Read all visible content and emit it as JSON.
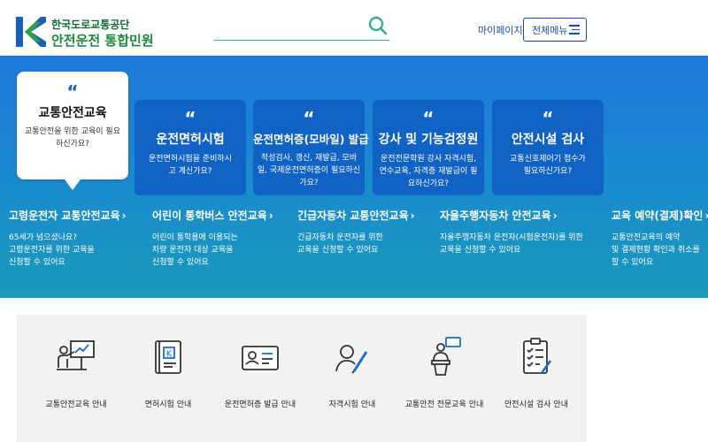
{
  "header": {
    "logo_line1": "한국도로교통공단",
    "logo_line2": "안전운전 통합민원",
    "search_placeholder": "",
    "mypage_label": "마이페이지",
    "allmenu_label": "전체메뉴"
  },
  "hero": {
    "quote_mark": "“",
    "cards": [
      {
        "title": "교통안전교육",
        "desc": "교통안전을 위한 교육이 필요하신가요?"
      },
      {
        "title": "운전면허시험",
        "desc": "운전면허시험을 준비하시고 계신가요?"
      },
      {
        "title": "운전면허증(모바일) 발급",
        "desc": "적성검사, 갱신, 재발급, 모바일, 국제운전면허증이 필요하신가요?"
      },
      {
        "title": "강사 및 기능검정원",
        "desc": "운전전문학원 강사 자격시험, 연수교육, 자격증 재발급이 필요하신가요?"
      },
      {
        "title": "안전시설 검사",
        "desc": "교통신호제어기 접수가 필요하신가요?"
      }
    ],
    "chevron": "›",
    "subs": [
      {
        "title": "고령운전자 교통안전교육",
        "desc": "65세가 넘으셨나요?\n고령운전자를 위한 교육을\n신청할 수 있어요"
      },
      {
        "title": "어린이 통학버스 안전교육",
        "desc": "어린이 통학용에 이용되는\n차량 운전자 대상 교육을\n신청할 수 있어요"
      },
      {
        "title": "긴급자동차 교통안전교육",
        "desc": "긴급자동차 운전자를 위한\n교육을 신청할 수 있어요"
      },
      {
        "title": "자율주행자동차 안전교육",
        "desc": "자율주행자동차 운전자(시험운전자)를 위한\n교육을 신청할 수 있어요"
      },
      {
        "title": "교육 예약(결제)확인",
        "desc": "교통안전교육의 예약\n및 결제현황 확인과 취소를\n할 수 있어요"
      }
    ]
  },
  "quick_links": [
    {
      "label": "교통안전교육 안내",
      "icon": "teacher-board-icon"
    },
    {
      "label": "면허시험 안내",
      "icon": "license-book-icon"
    },
    {
      "label": "운전면허증 발급 안내",
      "icon": "id-card-icon"
    },
    {
      "label": "자격시험 안내",
      "icon": "exam-pencil-icon"
    },
    {
      "label": "교통안전 전문교육 안내",
      "icon": "lecturer-podium-icon"
    },
    {
      "label": "안전시설 검사 안내",
      "icon": "checklist-icon"
    }
  ],
  "colors": {
    "primary": "#1062c4",
    "brand_green": "#1d8a3a",
    "nav_blue": "#1c4aa8"
  }
}
